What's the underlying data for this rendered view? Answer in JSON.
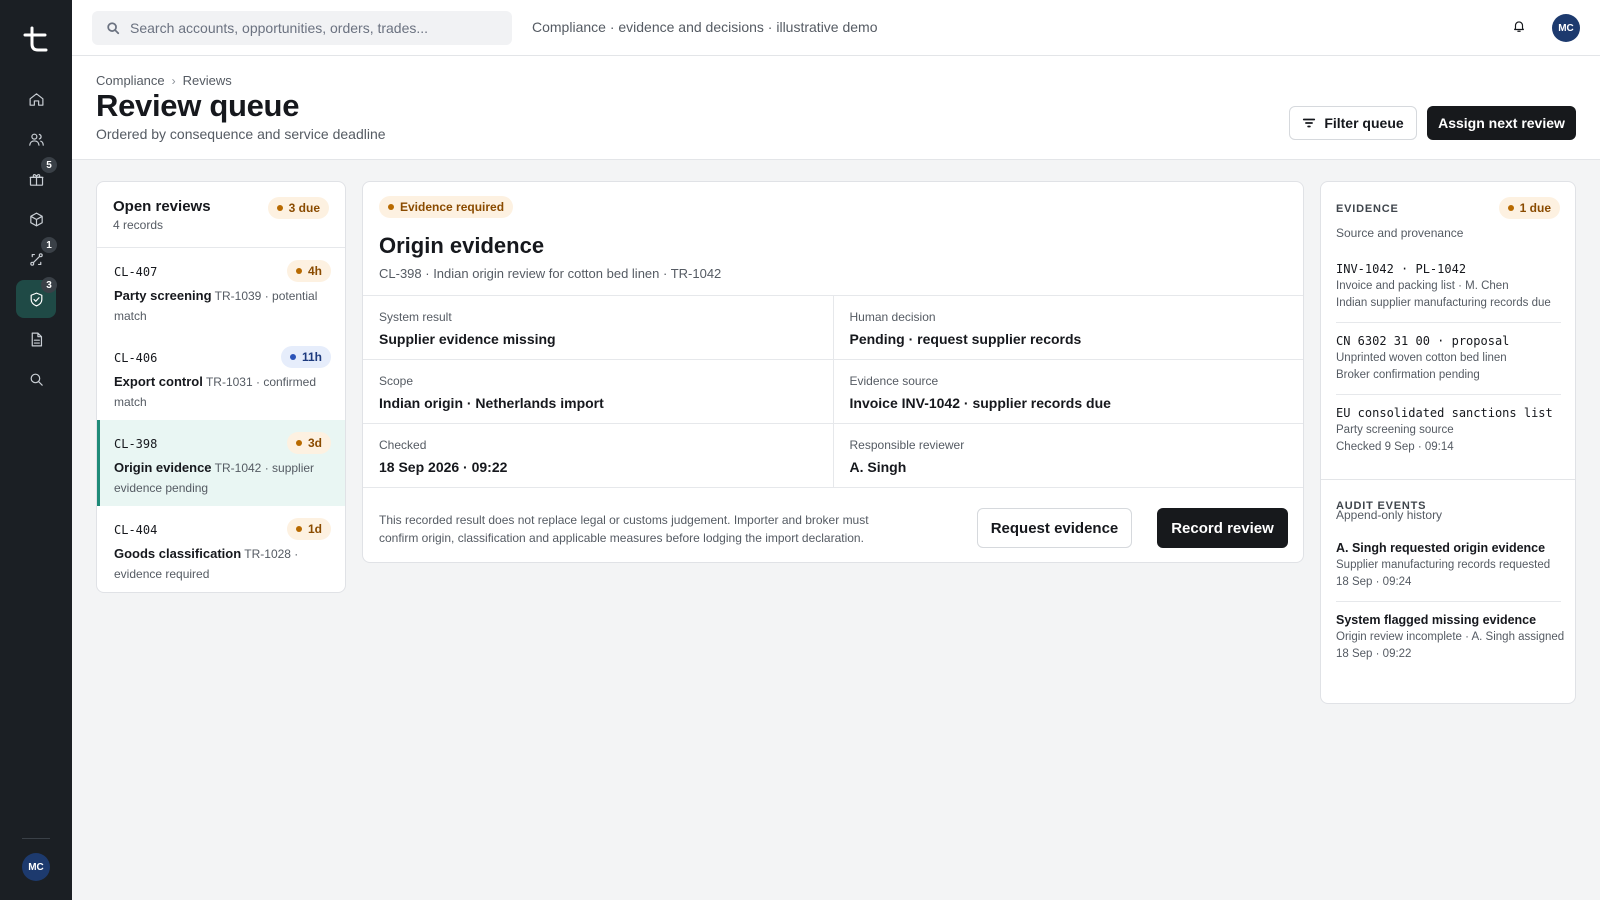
{
  "sidebar": {
    "logo": "t",
    "items": [
      {
        "name": "home-icon",
        "badge": ""
      },
      {
        "name": "users-icon",
        "badge": ""
      },
      {
        "name": "gift-icon",
        "badge": "5"
      },
      {
        "name": "package-icon",
        "badge": ""
      },
      {
        "name": "workflow-icon",
        "badge": "1"
      },
      {
        "name": "shield-check-icon",
        "badge": "3",
        "active": true
      },
      {
        "name": "document-icon",
        "badge": ""
      },
      {
        "name": "search-icon",
        "badge": ""
      }
    ],
    "avatar": "MC"
  },
  "topbar": {
    "search_placeholder": "Search accounts, opportunities, orders, trades...",
    "context": "Compliance · evidence and decisions · illustrative demo",
    "avatar": "MC"
  },
  "header": {
    "breadcrumb": [
      "Compliance",
      "Reviews"
    ],
    "breadcrumb_sep": "›",
    "title": "Review queue",
    "subtitle": "Ordered by consequence and service deadline",
    "filter_label": "Filter queue",
    "assign_label": "Assign next review"
  },
  "queue": {
    "title": "Open reviews",
    "count": "4 records",
    "due_badge": "3 due",
    "items": [
      {
        "id": "CL-407",
        "due": "4h",
        "tone": "amber",
        "title": "Party screening",
        "ref": "TR-1039",
        "desc": "potential match"
      },
      {
        "id": "CL-406",
        "due": "11h",
        "tone": "blue",
        "title": "Export control",
        "ref": "TR-1031",
        "desc": "confirmed match"
      },
      {
        "id": "CL-398",
        "due": "3d",
        "tone": "amber",
        "title": "Origin evidence",
        "ref": "TR-1042",
        "desc": "supplier evidence pending",
        "active": true
      },
      {
        "id": "CL-404",
        "due": "1d",
        "tone": "amber",
        "title": "Goods classification",
        "ref": "TR-1028",
        "desc": "evidence required"
      }
    ]
  },
  "detail": {
    "status": "Evidence required",
    "title": "Origin evidence",
    "subtitle": "CL-398 · Indian origin review for cotton bed linen · TR-1042",
    "fields": [
      {
        "label": "System result",
        "value": "Supplier evidence missing"
      },
      {
        "label": "Human decision",
        "value": "Pending · request supplier records"
      },
      {
        "label": "Scope",
        "value": "Indian origin · Netherlands import"
      },
      {
        "label": "Evidence source",
        "value": "Invoice INV-1042 · supplier records due"
      },
      {
        "label": "Checked",
        "value": "18 Sep 2026 · 09:22"
      },
      {
        "label": "Responsible reviewer",
        "value": "A. Singh"
      }
    ],
    "note": "This recorded result does not replace legal or customs judgement. Importer and broker must confirm origin, classification and applicable measures before lodging the import declaration.",
    "request_label": "Request evidence",
    "record_label": "Record review"
  },
  "evidence": {
    "heading": "EVIDENCE",
    "due_badge": "1 due",
    "subtitle": "Source and provenance",
    "items": [
      {
        "code": "INV-1042 · PL-1042",
        "line1": "Invoice and packing list · M. Chen",
        "line2": "Indian supplier manufacturing records due"
      },
      {
        "code": "CN 6302 31 00 · proposal",
        "line1": "Unprinted woven cotton bed linen",
        "line2": "Broker confirmation pending"
      },
      {
        "code": "EU consolidated sanctions list",
        "line1": "Party screening source",
        "line2": "Checked 9 Sep · 09:14"
      }
    ]
  },
  "audit": {
    "heading": "AUDIT EVENTS",
    "subtitle": "Append-only history",
    "events": [
      {
        "title": "A. Singh requested origin evidence",
        "line1": "Supplier manufacturing records requested",
        "line2": "18 Sep · 09:24"
      },
      {
        "title": "System flagged missing evidence",
        "line1": "Origin review incomplete · A. Singh assigned",
        "line2": "18 Sep · 09:22"
      }
    ]
  }
}
